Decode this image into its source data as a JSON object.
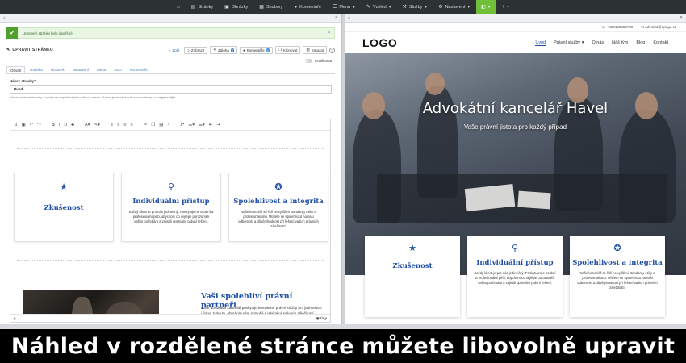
{
  "topbar": {
    "items": [
      {
        "icon": "home-icon",
        "label": ""
      },
      {
        "icon": "pages-icon",
        "label": "Stránky"
      },
      {
        "icon": "images-icon",
        "label": "Obrázky"
      },
      {
        "icon": "files-icon",
        "label": "Soubory"
      },
      {
        "icon": "comments-icon",
        "label": "Komentáře"
      },
      {
        "icon": "menu-icon",
        "label": "Menu"
      },
      {
        "icon": "brush-icon",
        "label": "Vzhled"
      },
      {
        "icon": "services-icon",
        "label": "Služby"
      },
      {
        "icon": "settings-icon",
        "label": "Nastavení"
      },
      {
        "icon": "active-icon",
        "label": ""
      },
      {
        "icon": "plus-icon",
        "label": ""
      }
    ],
    "active_color": "#6fbf3b"
  },
  "editor": {
    "alert": "Upravení stránky bylo úspěšné",
    "title": "UPRAVIT STRÁNKU",
    "buttons": {
      "back": "Zpět",
      "view": "Zobrazit",
      "history": "Záloha",
      "history_count": "2",
      "comments": "Komentáře",
      "comments_count": "0",
      "duplicate": "Klonovat",
      "delete": "Smazat"
    },
    "published_label": "Publikovat",
    "tabs": [
      "Obsah",
      "Rubrika",
      "Obrázek",
      "Nastavení",
      "Menu",
      "SEO",
      "Komentáře"
    ],
    "field_label": "Název stránky*",
    "field_value": "Úvod",
    "field_help": "Název webové stránky, použije se například jako odkaz v menu. Název je vhodné volit srozumitelný, co nejpřesnější.",
    "cards": [
      {
        "icon": "star-icon",
        "title": "Zkušenost",
        "text": ""
      },
      {
        "icon": "user-icon",
        "title": "Individuální přístup",
        "text": "Každý klient je pro nás jedinečný. Poskytujeme osobní a profesionální péči, abychom co nejlépe porozuměli vašim potřebám a zajistili optimální právní řešení."
      },
      {
        "icon": "award-icon",
        "title": "Spolehlivost a integrita",
        "text": "Naše kancelář se řídí nejvyššími standardy etiky a profesionalismu. Můžete se spolehnout na naši odbornost a důvěryhodnost při řešení vašich právních záležitostí."
      }
    ],
    "section_title": "Vaši spolehliví právní partneři",
    "section_text": "Naše advokátní kancelář poskytuje komplexní právní služby pro jednotlivce i firmy. Jsme tu, abychom vám pomohli s jakýmkoli právním záležitostí, které můžete mít.",
    "footer_left": "p",
    "footer_brand": "tiny"
  },
  "preview": {
    "phone": "+420123456789",
    "email": "advokat@npage.cz",
    "logo": "LOGO",
    "menu": [
      "Úvod",
      "Právní služby",
      "O nás",
      "Náš tým",
      "Blog",
      "Kontakt"
    ],
    "hero_title": "Advokátní kancelář Havel",
    "hero_subtitle": "Vaše právní jistota pro každý případ",
    "cards": [
      {
        "icon": "star-icon",
        "title": "Zkušenost",
        "text": ""
      },
      {
        "icon": "user-icon",
        "title": "Individuální přístup",
        "text": "Každý klient je pro nás jedinečný. Poskytujeme osobní a profesionální péči, abychom co nejlépe porozuměli vašim potřebám a zajistili optimální právní řešení."
      },
      {
        "icon": "award-icon",
        "title": "Spolehlivost a integrita",
        "text": "Naše kancelář se řídí nejvyššími standardy etiky a profesionalismu. Můžete se spolehnout na naši odbornost a důvěryhodnost při řešení vašich právních záležitostí."
      }
    ],
    "accent": "#1f4fa6"
  },
  "caption": "Náhled v rozdělené stránce můžete libovolně upravit"
}
